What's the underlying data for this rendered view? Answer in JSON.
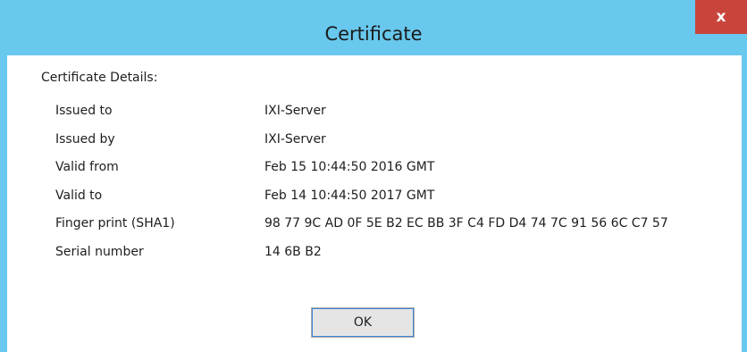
{
  "window": {
    "title": "Certificate",
    "close_label": "x"
  },
  "details": {
    "heading": "Certificate Details:",
    "rows": [
      {
        "label": "Issued to",
        "value": "IXI-Server"
      },
      {
        "label": "Issued by",
        "value": "IXI-Server"
      },
      {
        "label": "Valid from",
        "value": "Feb 15 10:44:50 2016 GMT"
      },
      {
        "label": "Valid to",
        "value": "Feb 14 10:44:50 2017 GMT"
      },
      {
        "label": "Finger print (SHA1)",
        "value": "98 77 9C AD 0F 5E B2 EC BB 3F C4 FD D4 74 7C 91 56 6C C7 57"
      },
      {
        "label": "Serial number",
        "value": "14 6B B2"
      }
    ]
  },
  "buttons": {
    "ok_label": "OK"
  },
  "colors": {
    "titlebar": "#68c8ee",
    "close_button": "#c9453c",
    "button_focus": "#3c86d6"
  },
  "icons": {
    "close": "close-icon"
  }
}
